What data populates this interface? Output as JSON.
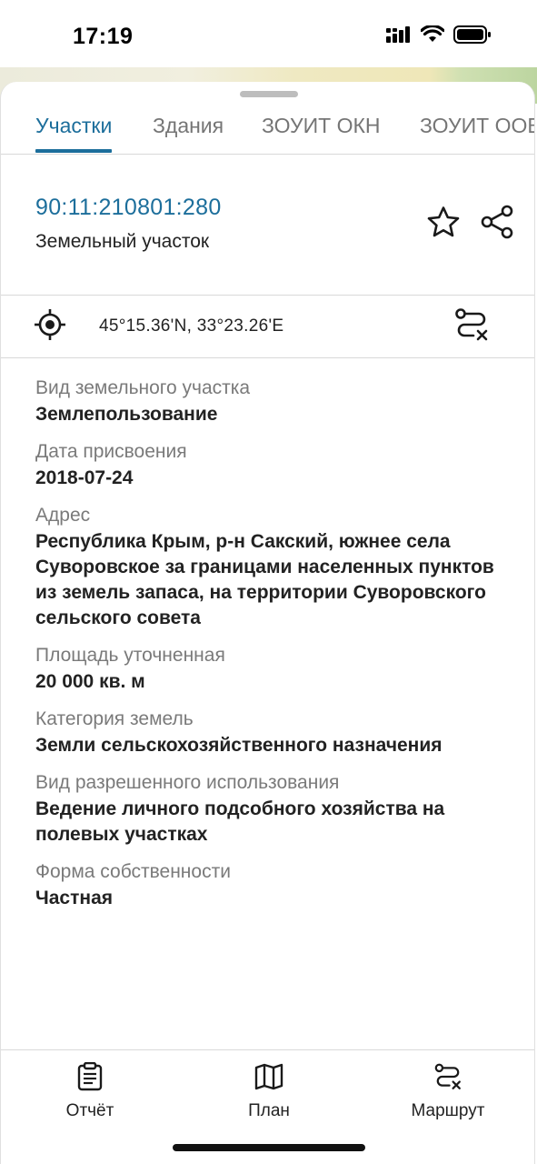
{
  "status_bar": {
    "time": "17:19"
  },
  "tabs": [
    {
      "label": "Участки",
      "active": true
    },
    {
      "label": "Здания",
      "active": false
    },
    {
      "label": "ЗОУИТ ОКН",
      "active": false
    },
    {
      "label": "ЗОУИТ ООВ",
      "active": false
    }
  ],
  "parcel": {
    "cadastral_number": "90:11:210801:280",
    "type": "Земельный участок"
  },
  "coordinates": "45°15.36'N, 33°23.26'E",
  "fields": [
    {
      "label": "Вид земельного участка",
      "value": "Землепользование"
    },
    {
      "label": "Дата присвоения",
      "value": "2018-07-24"
    },
    {
      "label": "Адрес",
      "value": "Республика Крым, р-н Сакский, южнее села Суворовское за границами населенных пунктов из земель запаса, на территории Суворовского сельского совета"
    },
    {
      "label": "Площадь уточненная",
      "value": "20 000 кв. м"
    },
    {
      "label": "Категория земель",
      "value": "Земли сельскохозяйственного назначения"
    },
    {
      "label": "Вид разрешенного использования",
      "value": "Ведение личного подсобного хозяйства на полевых участках"
    },
    {
      "label": "Форма собственности",
      "value": "Частная"
    }
  ],
  "bottom_bar": {
    "report_label": "Отчёт",
    "plan_label": "План",
    "route_label": "Маршрут"
  },
  "colors": {
    "accent": "#1c6e9b",
    "label_gray": "#7a7a7a",
    "text": "#222222",
    "divider": "#d9d9d9"
  },
  "icons": {
    "favorite": "star-icon",
    "share": "share-icon",
    "locate": "crosshair-icon",
    "route": "route-icon",
    "report": "clipboard-icon",
    "plan": "map-icon"
  }
}
